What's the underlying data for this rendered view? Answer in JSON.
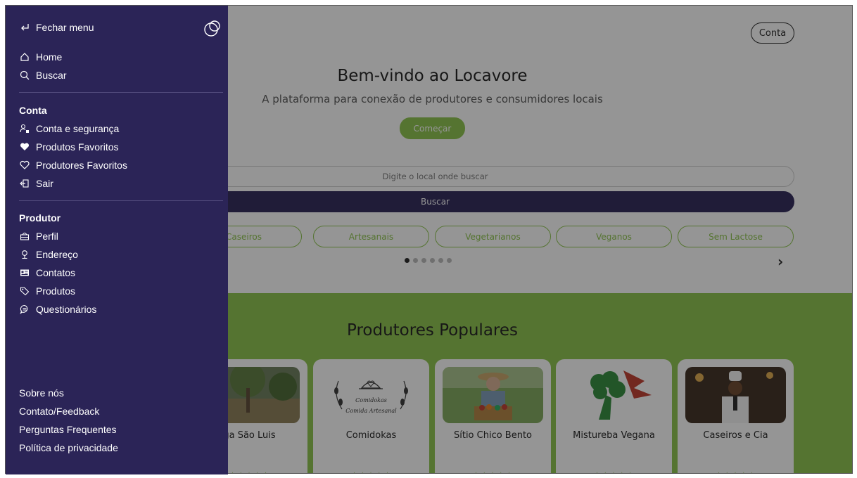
{
  "header": {
    "account_button": "Conta"
  },
  "hero": {
    "title": "Bem-vindo ao Locavore",
    "subtitle": "A plataforma para conexão de produtores e consumidores locais",
    "start_button": "Começar"
  },
  "search": {
    "placeholder": "Digite o local onde buscar",
    "button_label": "Buscar"
  },
  "categories": [
    "Caseiros",
    "Artesanais",
    "Vegetarianos",
    "Veganos",
    "Sem Lactose"
  ],
  "carousel": {
    "dot_count": 6,
    "active_index": 0
  },
  "popular": {
    "title": "Produtores Populares",
    "cards": [
      {
        "name": "ga São Luis",
        "stars": "☆☆☆☆☆"
      },
      {
        "name": "Comidokas",
        "stars": "☆☆☆☆☆",
        "logo_text_1": "Comidokas",
        "logo_text_2": "Comida Artesanal"
      },
      {
        "name": "Sítio Chico Bento",
        "stars": "☆☆☆☆☆"
      },
      {
        "name": "Mistureba Vegana",
        "stars": "☆☆☆☆☆"
      },
      {
        "name": "Caseiros e Cia",
        "stars": "☆☆☆☆☆"
      }
    ]
  },
  "drawer": {
    "close_label": "Fechar menu",
    "nav": [
      {
        "label": "Home",
        "icon": "home-icon"
      },
      {
        "label": "Buscar",
        "icon": "search-icon"
      }
    ],
    "account_section": {
      "title": "Conta",
      "items": [
        {
          "label": "Conta e segurança",
          "icon": "user-lock-icon"
        },
        {
          "label": "Produtos Favoritos",
          "icon": "heart-filled-icon"
        },
        {
          "label": "Produtores Favoritos",
          "icon": "heart-outline-icon"
        },
        {
          "label": "Sair",
          "icon": "logout-icon"
        }
      ]
    },
    "producer_section": {
      "title": "Produtor",
      "items": [
        {
          "label": "Perfil",
          "icon": "basket-icon"
        },
        {
          "label": "Endereço",
          "icon": "location-pin-icon"
        },
        {
          "label": "Contatos",
          "icon": "contact-card-icon"
        },
        {
          "label": "Produtos",
          "icon": "tags-icon"
        },
        {
          "label": "Questionários",
          "icon": "chat-icon"
        }
      ]
    },
    "footer_links": [
      "Sobre nós",
      "Contato/Feedback",
      "Perguntas Frequentes",
      "Política de privacidade"
    ]
  },
  "colors": {
    "primary_dark": "#2b2457",
    "accent_green": "#8bc34a"
  }
}
